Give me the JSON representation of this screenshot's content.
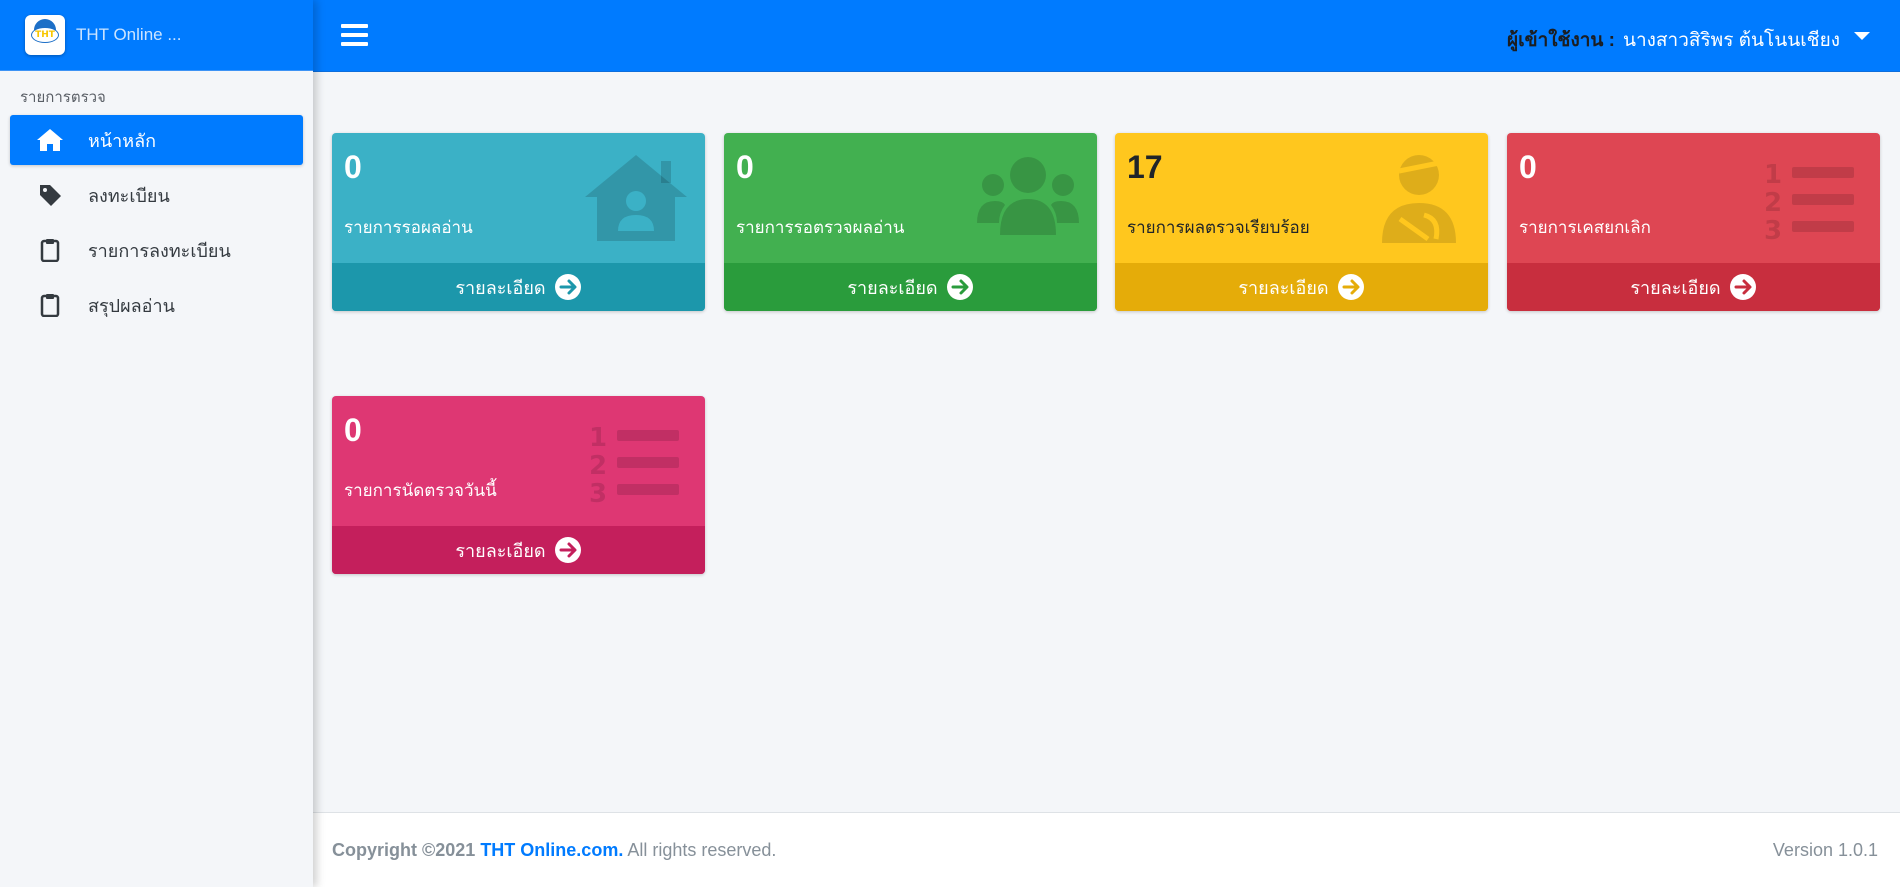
{
  "brand": {
    "name": "THT Online ...",
    "logo_text": "THT"
  },
  "sidebar": {
    "header": "รายการตรวจ",
    "items": [
      {
        "label": "หน้าหลัก",
        "icon": "home-icon",
        "active": true
      },
      {
        "label": "ลงทะเบียน",
        "icon": "tag-icon",
        "active": false
      },
      {
        "label": "รายการลงทะเบียน",
        "icon": "clipboard-icon",
        "active": false
      },
      {
        "label": "สรุปผลอ่าน",
        "icon": "clipboard-icon",
        "active": false
      }
    ]
  },
  "topbar": {
    "user_label": "ผู้เข้าใช้งาน :",
    "user_name": "นางสาวสิริพร ต้นโนนเชียง"
  },
  "cards": [
    {
      "count": "0",
      "label": "รายการรอผลอ่าน",
      "footer": "รายละเอียด",
      "icon": "home-user-icon",
      "color": "#3bb1c6"
    },
    {
      "count": "0",
      "label": "รายการรอตรวจผลอ่าน",
      "footer": "รายละเอียด",
      "icon": "users-icon",
      "color": "#42b050"
    },
    {
      "count": "17",
      "label": "รายการผลตรวจเรียบร้อย",
      "footer": "รายละเอียด",
      "icon": "injured-user-icon",
      "color": "#ffc71e"
    },
    {
      "count": "0",
      "label": "รายการเคสยกเลิก",
      "footer": "รายละเอียด",
      "icon": "numbered-list-icon",
      "color": "#de4653"
    },
    {
      "count": "0",
      "label": "รายการนัดตรวจวันนี้",
      "footer": "รายละเอียด",
      "icon": "numbered-list-icon",
      "color": "#de3773"
    }
  ],
  "footer": {
    "copyright": "Copyright ©2021",
    "site": "THT Online.com.",
    "rights": "All rights reserved.",
    "version": "Version 1.0.1"
  }
}
